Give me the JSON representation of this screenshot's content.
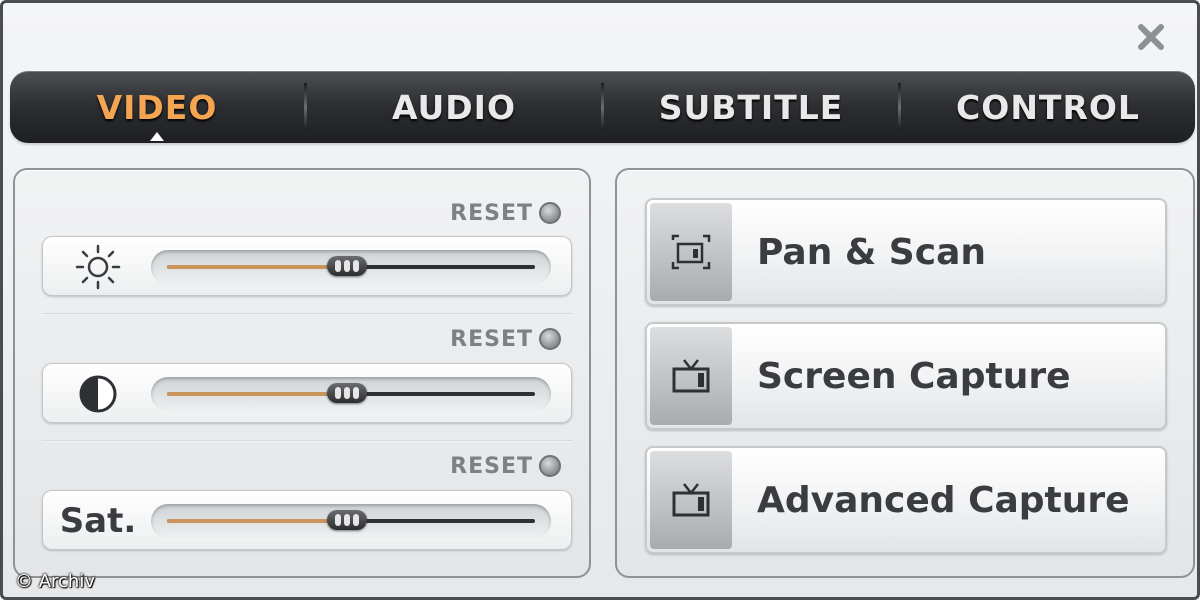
{
  "window": {
    "close_label": "×"
  },
  "tabs": [
    {
      "label": "VIDEO",
      "active": true
    },
    {
      "label": "AUDIO",
      "active": false
    },
    {
      "label": "SUBTITLE",
      "active": false
    },
    {
      "label": "CONTROL",
      "active": false
    }
  ],
  "video": {
    "reset_label": "RESET",
    "sliders": [
      {
        "name": "brightness",
        "icon": "sun-icon",
        "value_percent": 49
      },
      {
        "name": "contrast",
        "icon": "contrast-icon",
        "value_percent": 49
      },
      {
        "name": "saturation",
        "label": "Sat.",
        "value_percent": 49
      }
    ]
  },
  "actions": [
    {
      "label": "Pan & Scan",
      "icon": "pan-scan-icon"
    },
    {
      "label": "Screen Capture",
      "icon": "tv-icon"
    },
    {
      "label": "Advanced Capture",
      "icon": "tv-icon"
    }
  ],
  "footer": {
    "copyright": "© Archiv"
  },
  "colors": {
    "active_tab": "#f4a552",
    "slider_fill": "#c9955c",
    "tab_bar": "#2c2e31"
  }
}
